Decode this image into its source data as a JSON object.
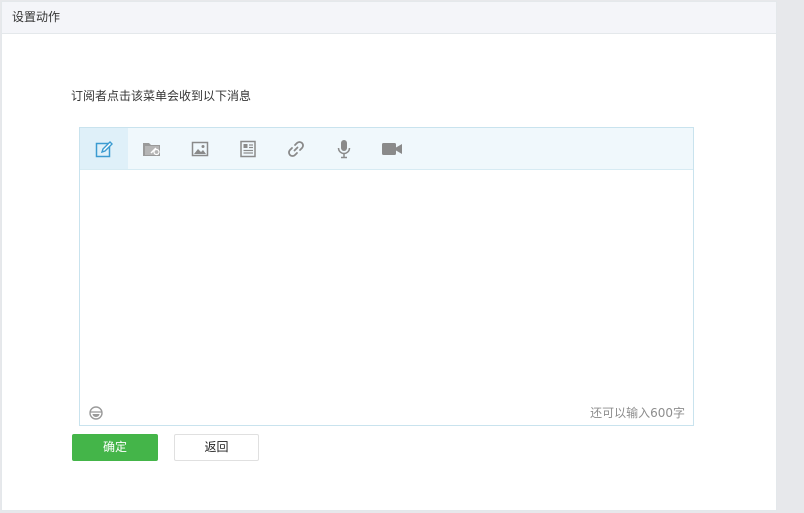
{
  "header": {
    "title": "设置动作"
  },
  "instruction": "订阅者点击该菜单会收到以下消息",
  "editor": {
    "tools": [
      {
        "icon": "edit-text-icon",
        "label": ""
      },
      {
        "icon": "folder-attach-icon",
        "label": ""
      },
      {
        "icon": "image-icon",
        "label": ""
      },
      {
        "icon": "article-icon",
        "label": ""
      },
      {
        "icon": "link-icon",
        "label": ""
      },
      {
        "icon": "microphone-icon",
        "label": ""
      },
      {
        "icon": "video-camera-icon",
        "label": ""
      }
    ],
    "active_tool": "edit-text-icon",
    "text_value": "",
    "counter": "还可以输入600字"
  },
  "buttons": {
    "confirm": "确定",
    "back": "返回"
  },
  "colors": {
    "primary": "#44b549",
    "toolbar_bg": "#f0f8fc",
    "border": "#c9e3ee"
  }
}
